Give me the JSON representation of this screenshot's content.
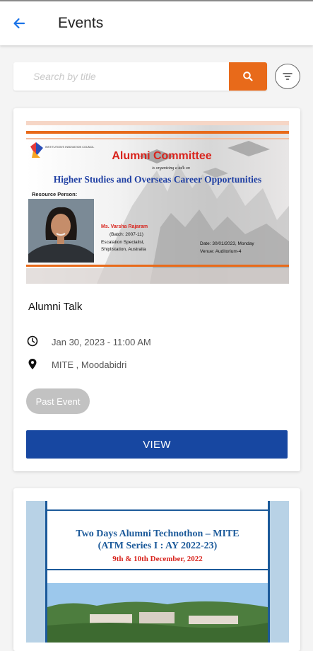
{
  "header": {
    "title": "Events",
    "back_icon": "arrow-left-icon"
  },
  "search": {
    "placeholder": "Search by title",
    "value": "",
    "button_icon": "search-icon",
    "filter_icon": "filter-icon"
  },
  "colors": {
    "accent_orange": "#e86a1a",
    "primary_blue": "#1747a1",
    "badge_gray": "#c2c2c2",
    "back_arrow_blue": "#1a73e8"
  },
  "events": [
    {
      "title": "Alumni Talk",
      "datetime": "Jan 30, 2023 - 11:00 AM",
      "location": "MITE , Moodabidri",
      "status": "Past Event",
      "action_label": "VIEW",
      "poster": {
        "logo_text": "INSTITUTION'S INNOVATION COUNCIL",
        "heading": "Alumni Committee",
        "subheading": "is organizing a talk on",
        "topic": "Higher Studies and Overseas Career Opportunities",
        "resource_label": "Resource Person:",
        "speaker_name": "Ms. Varsha Rajaram",
        "speaker_batch": "(Batch: 2007-11)",
        "speaker_role_1": "Escalation Specialist,",
        "speaker_role_2": "Shiplistation, Australia",
        "date_text": "Date: 30/01/2023, Monday",
        "venue_text": "Venue: Auditorium-4"
      }
    },
    {
      "poster": {
        "line1": "Two Days Alumni Technothon – MITE",
        "line2": "(ATM Series I : AY 2022-23)",
        "line3": "9th & 10th December, 2022"
      }
    }
  ]
}
